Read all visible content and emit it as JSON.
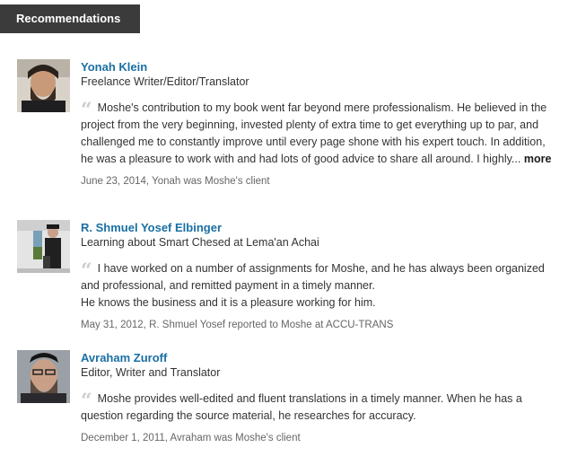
{
  "section": {
    "title": "Recommendations"
  },
  "recommendations": [
    {
      "name": "Yonah Klein",
      "headline": "Freelance Writer/Editor/Translator",
      "text": "Moshe's contribution to my book went far beyond mere professionalism. He believed in the project from the very beginning, invested plenty of extra time to get everything up to par, and challenged me to constantly improve until every page shone with his expert touch. In addition, he was a pleasure to work with and had lots of good advice to share all around. I highly...",
      "more_label": "more",
      "meta": "June 23, 2014, Yonah was Moshe's client"
    },
    {
      "name": "R. Shmuel Yosef Elbinger",
      "headline": "Learning about Smart Chesed at Lema'an Achai",
      "text_line1": "I have worked on a number of assignments for Moshe, and he has always been organized and professional, and remitted payment in a timely manner.",
      "text_line2": "He knows the business and it is a pleasure working for him.",
      "meta": "May 31, 2012, R. Shmuel Yosef reported to Moshe at ACCU-TRANS"
    },
    {
      "name": "Avraham Zuroff",
      "headline": "Editor, Writer and Translator",
      "text": "Moshe provides well-edited and fluent translations in a timely manner. When he has a question regarding the source material, he researches for accuracy.",
      "meta": "December 1, 2011, Avraham was Moshe's client"
    }
  ],
  "icons": {
    "quote": "quote-icon"
  }
}
